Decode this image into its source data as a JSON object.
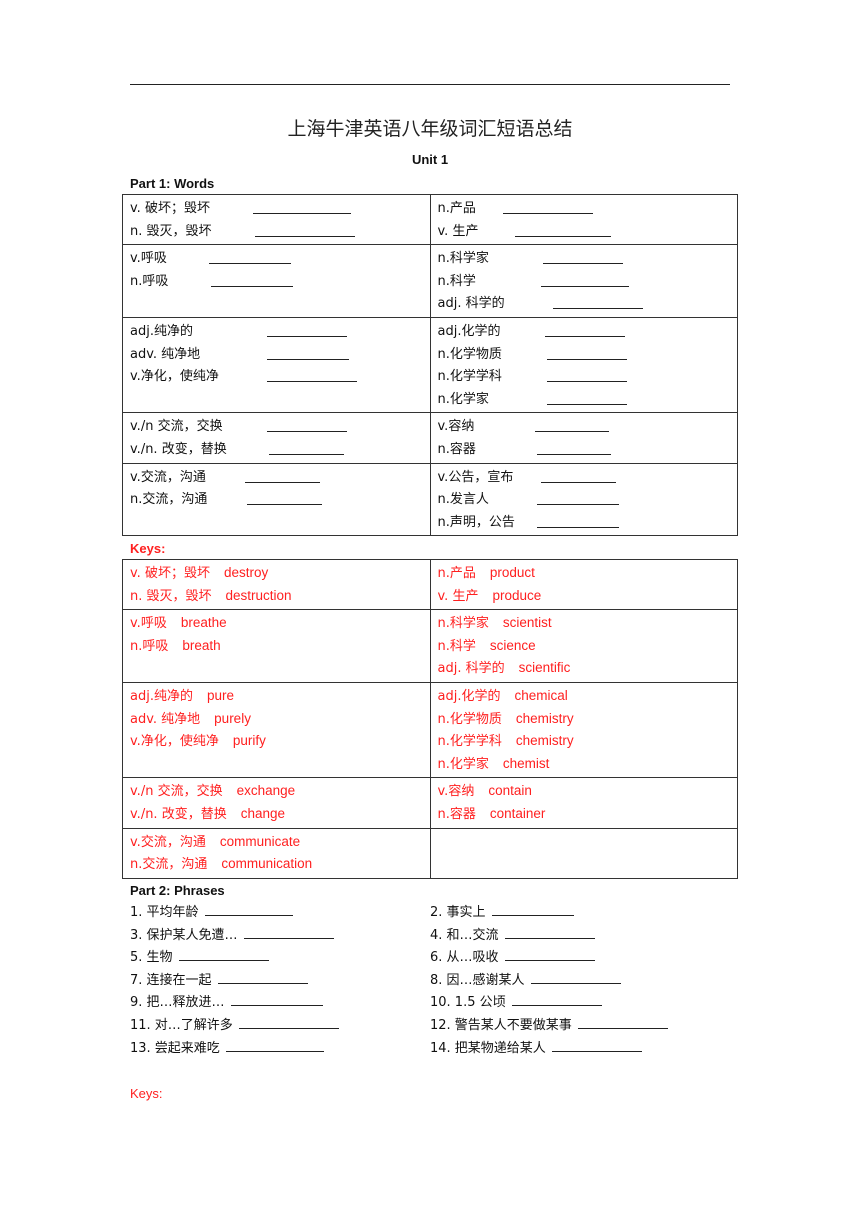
{
  "document": {
    "title": "上海牛津英语八年级词汇短语总结",
    "unit": "Unit 1",
    "part1_label": "Part 1: Words",
    "keys_label": "Keys:",
    "part2_label": "Part 2: Phrases",
    "keys2_label": "Keys:",
    "colors": {
      "text": "#111111",
      "keys": "#ff2020"
    }
  },
  "words": [
    {
      "left": [
        "v.  破坏；毁坏",
        "n.  毁灭，毁坏"
      ],
      "right": [
        "n.产品",
        "v.  生产"
      ]
    },
    {
      "left": [
        "v.呼吸",
        "n.呼吸"
      ],
      "right": [
        "n.科学家",
        "n.科学",
        "adj.  科学的"
      ]
    },
    {
      "left": [
        "adj.纯净的",
        "adv.  纯净地",
        "v.净化，使纯净"
      ],
      "right": [
        "adj.化学的",
        "n.化学物质",
        "n.化学学科",
        "n.化学家"
      ]
    },
    {
      "left": [
        "v./n  交流，交换",
        "v./n.  改变，替换"
      ],
      "right": [
        "v.容纳",
        "n.容器"
      ]
    },
    {
      "left": [
        "v.交流，沟通",
        "n.交流，沟通"
      ],
      "right": [
        "v.公告，宣布",
        "n.发言人",
        "n.声明，公告"
      ]
    }
  ],
  "keys": [
    {
      "left": [
        [
          "v.  破坏；毁坏",
          "destroy"
        ],
        [
          "n.  毁灭，毁坏",
          "destruction"
        ]
      ],
      "right": [
        [
          "n.产品",
          "product"
        ],
        [
          "v.  生产",
          "produce"
        ]
      ]
    },
    {
      "left": [
        [
          "v.呼吸",
          "breathe"
        ],
        [
          "n.呼吸",
          "breath"
        ]
      ],
      "right": [
        [
          "n.科学家",
          "scientist"
        ],
        [
          "n.科学",
          "science"
        ],
        [
          "adj.  科学的",
          "scientific"
        ]
      ]
    },
    {
      "left": [
        [
          "adj.纯净的",
          "pure"
        ],
        [
          "adv.  纯净地",
          "purely"
        ],
        [
          "v.净化，使纯净",
          "purify"
        ]
      ],
      "right": [
        [
          "adj.化学的",
          "chemical"
        ],
        [
          "n.化学物质",
          "chemistry"
        ],
        [
          "n.化学学科",
          "chemistry"
        ],
        [
          "n.化学家",
          "chemist"
        ]
      ]
    },
    {
      "left": [
        [
          "v./n  交流，交换",
          "exchange"
        ],
        [
          "v./n.  改变，替换",
          "change"
        ]
      ],
      "right": [
        [
          "v.容纳",
          "contain"
        ],
        [
          "n.容器",
          "container"
        ]
      ]
    },
    {
      "left": [
        [
          "v.交流，沟通",
          "communicate"
        ],
        [
          "n.交流，沟通",
          "communication"
        ]
      ],
      "right": []
    }
  ],
  "phrases": [
    [
      "1.  平均年龄",
      "2.  事实上"
    ],
    [
      "3.  保护某人免遭…",
      "4.  和…交流"
    ],
    [
      "5.  生物",
      "6.  从…吸收"
    ],
    [
      "7.  连接在一起",
      "8.  因…感谢某人"
    ],
    [
      "9.  把…释放进…",
      "10. 1.5 公顷"
    ],
    [
      "11.  对…了解许多",
      "12.  警告某人不要做某事"
    ],
    [
      "13.  尝起来难吃",
      "14.  把某物递给某人"
    ]
  ]
}
